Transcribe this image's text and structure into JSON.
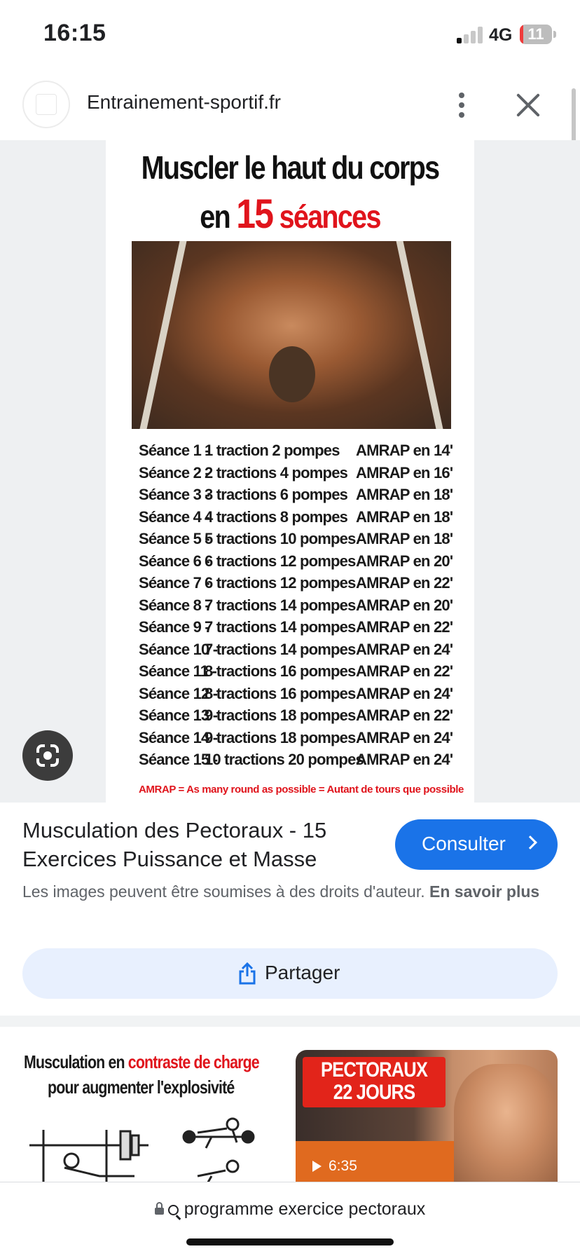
{
  "status_bar": {
    "time": "16:15",
    "network": "4G",
    "battery": "11",
    "battery_level": 0.11
  },
  "site_bar": {
    "site_name": "Entrainement-sportif.fr"
  },
  "image": {
    "title_line1": "Muscler le haut du corps",
    "title_line2_prefix": "en",
    "title_line2_number": "15",
    "title_line2_suffix": "séances",
    "sessions": [
      {
        "seance": "Séance  1 -",
        "exercices": "1 traction    2 pompes",
        "amrap": "AMRAP en 14'"
      },
      {
        "seance": "Séance  2 -",
        "exercices": "2 tractions  4 pompes",
        "amrap": "AMRAP en 16'"
      },
      {
        "seance": "Séance  3 -",
        "exercices": "3 tractions  6 pompes",
        "amrap": "AMRAP en 18'"
      },
      {
        "seance": "Séance  4 -",
        "exercices": "4 tractions  8 pompes",
        "amrap": "AMRAP en 18'"
      },
      {
        "seance": "Séance  5 -",
        "exercices": "5 tractions 10 pompes",
        "amrap": "AMRAP en 18'"
      },
      {
        "seance": "Séance  6 -",
        "exercices": "6 tractions 12 pompes",
        "amrap": "AMRAP en 20'"
      },
      {
        "seance": "Séance  7 -",
        "exercices": "6 tractions 12 pompes",
        "amrap": "AMRAP en 22'"
      },
      {
        "seance": "Séance  8 -",
        "exercices": "7 tractions 14 pompes",
        "amrap": "AMRAP en 20'"
      },
      {
        "seance": "Séance  9 -",
        "exercices": "7 tractions 14 pompes",
        "amrap": "AMRAP en 22'"
      },
      {
        "seance": "Séance 10 -",
        "exercices": "7 tractions 14 pompes",
        "amrap": "AMRAP en 24'"
      },
      {
        "seance": "Séance 11 -",
        "exercices": "8 tractions 16 pompes",
        "amrap": "AMRAP en 22'"
      },
      {
        "seance": "Séance 12 -",
        "exercices": "8 tractions 16 pompes",
        "amrap": "AMRAP en 24'"
      },
      {
        "seance": "Séance 13 -",
        "exercices": "9 tractions 18 pompes",
        "amrap": "AMRAP en 22'"
      },
      {
        "seance": "Séance 14 -",
        "exercices": "9 tractions 18 pompes",
        "amrap": "AMRAP en 24'"
      },
      {
        "seance": "Séance 15 -",
        "exercices": "10 tractions 20 pompes",
        "amrap": "AMRAP en 24'"
      }
    ],
    "footnote": "AMRAP = As many round as possible = Autant de tours que possible"
  },
  "result": {
    "title": "Musculation des Pectoraux - 15 Exercices Puissance et Masse",
    "consult_label": "Consulter",
    "rights_text": "Les images peuvent être soumises à des droits d'auteur.",
    "rights_link": "En savoir plus",
    "share_label": "Partager"
  },
  "related": [
    {
      "line1_prefix": "Musculation en ",
      "line1_highlight": "contraste de charge",
      "line2": "pour augmenter l'explosivité"
    },
    {
      "title_line1": "PECTORAUX",
      "title_line2": "22 JOURS",
      "duration": "6:35"
    }
  ],
  "bottom_bar": {
    "query": "programme exercice pectoraux"
  },
  "colors": {
    "accent": "#1a73e8",
    "share_bg": "#e8f0fe",
    "poster_red": "#e0141c"
  }
}
